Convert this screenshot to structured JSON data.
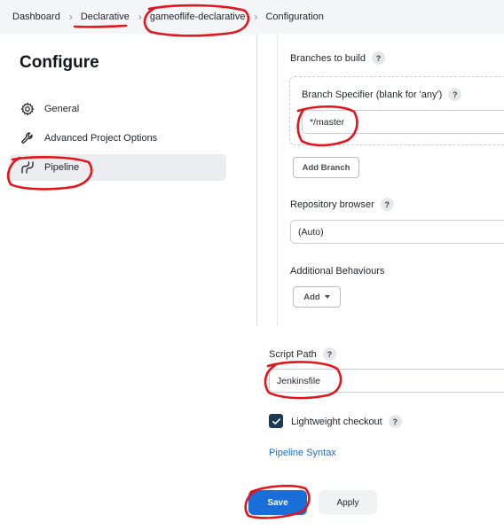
{
  "breadcrumb": {
    "items": [
      "Dashboard",
      "Declarative",
      "gameoflife-declarative",
      "Configuration"
    ],
    "separator": "›"
  },
  "sidebar": {
    "title": "Configure",
    "items": [
      {
        "label": "General",
        "icon": "gear-icon"
      },
      {
        "label": "Advanced Project Options",
        "icon": "wrench-icon"
      },
      {
        "label": "Pipeline",
        "icon": "pipeline-icon",
        "active": true
      }
    ]
  },
  "scm": {
    "branches_label": "Branches to build",
    "branch_specifier_label": "Branch Specifier (blank for 'any')",
    "branch_specifier_value": "*/master",
    "add_branch_label": "Add Branch",
    "repo_browser_label": "Repository browser",
    "repo_browser_value": "(Auto)",
    "additional_behaviours_label": "Additional Behaviours",
    "add_label": "Add"
  },
  "pipeline": {
    "script_path_label": "Script Path",
    "script_path_value": "Jenkinsfile",
    "lightweight_label": "Lightweight checkout",
    "lightweight_checked": true,
    "syntax_link": "Pipeline Syntax"
  },
  "actions": {
    "save_label": "Save",
    "apply_label": "Apply"
  },
  "help_glyph": "?",
  "colors": {
    "primary": "#1a6ed8",
    "link": "#1a6ecc",
    "annotation": "#e3141b"
  }
}
